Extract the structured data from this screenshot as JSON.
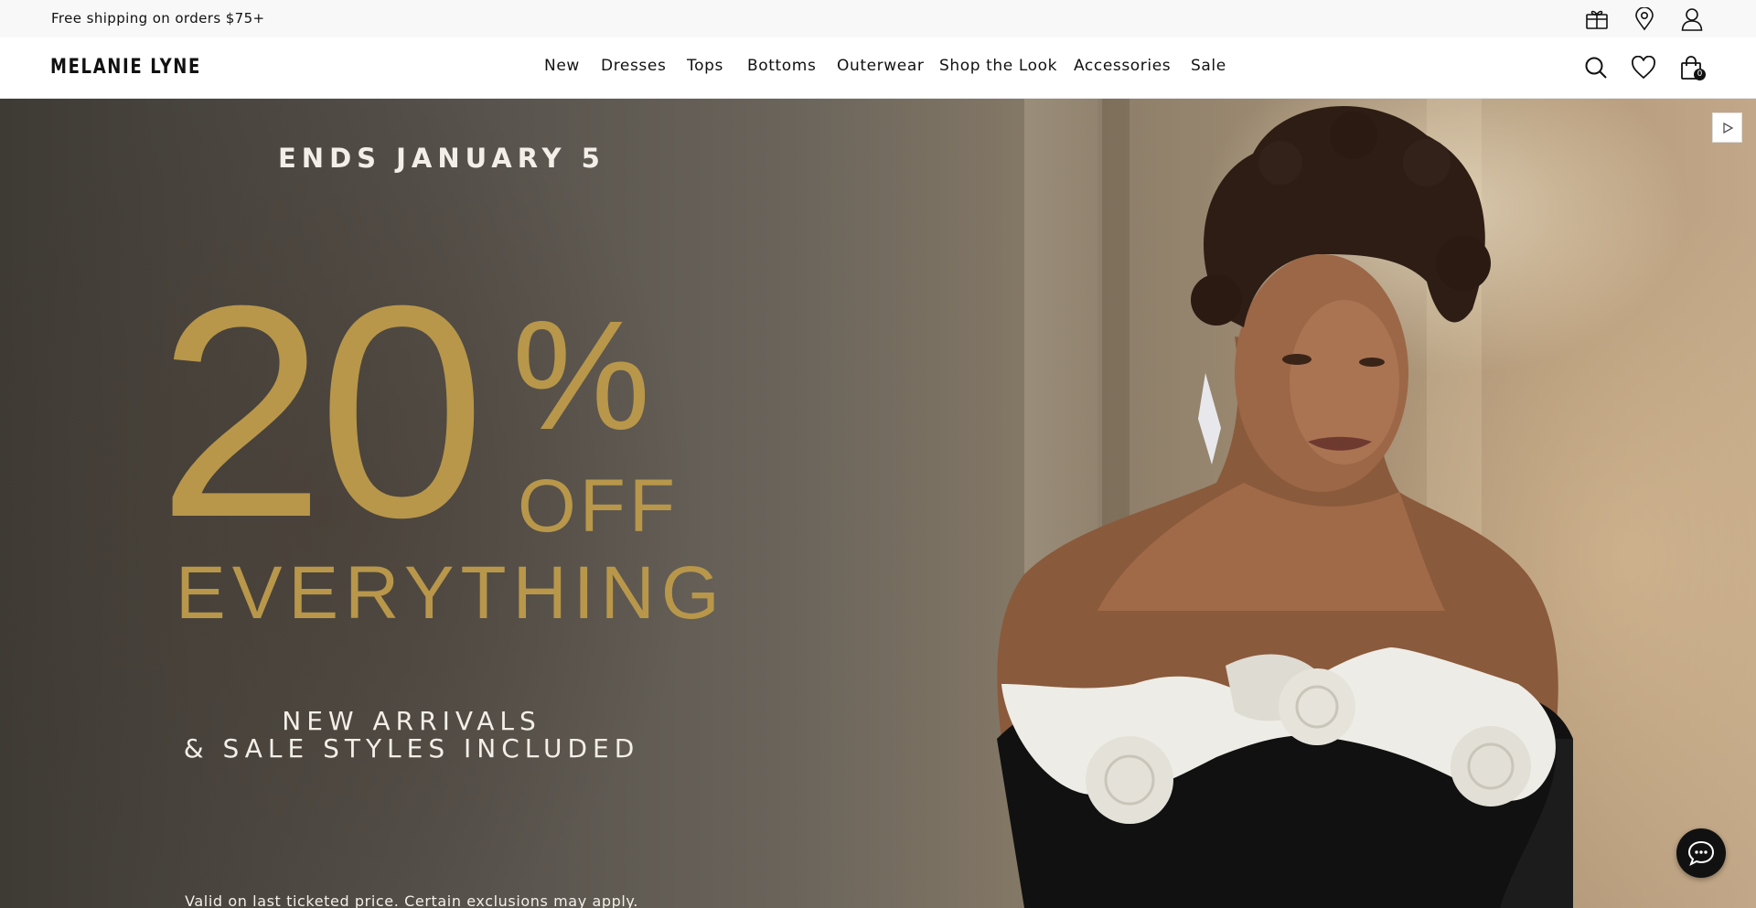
{
  "announcement": {
    "text": "Free shipping on orders $75+"
  },
  "utility_icons": [
    "gift-card-icon",
    "store-locator-icon",
    "account-icon"
  ],
  "brand": {
    "logo": "MELANIE LYNE"
  },
  "nav": {
    "items": [
      {
        "label": "New"
      },
      {
        "label": "Dresses"
      },
      {
        "label": "Tops"
      },
      {
        "label": "Bottoms"
      },
      {
        "label": "Outerwear"
      },
      {
        "label": "Shop the Look"
      },
      {
        "label": "Accessories"
      },
      {
        "label": "Sale"
      }
    ]
  },
  "header_icons": [
    "search-icon",
    "wishlist-heart-icon",
    "shopping-bag-icon"
  ],
  "cart": {
    "count": "0"
  },
  "hero": {
    "ends": "ENDS JANUARY 5",
    "discount_number": "20",
    "discount_symbol": "%",
    "discount_off": "OFF",
    "everything": "EVERYTHING",
    "sub_line1": "NEW ARRIVALS",
    "sub_line2": "& SALE STYLES INCLUDED",
    "fine_print": "Valid on last ticketed price. Certain exclusions may apply.",
    "accent_color": "#b8974a"
  },
  "video_control": {
    "icon": "play-icon"
  },
  "chat": {
    "icon": "chat-bubble-icon"
  }
}
